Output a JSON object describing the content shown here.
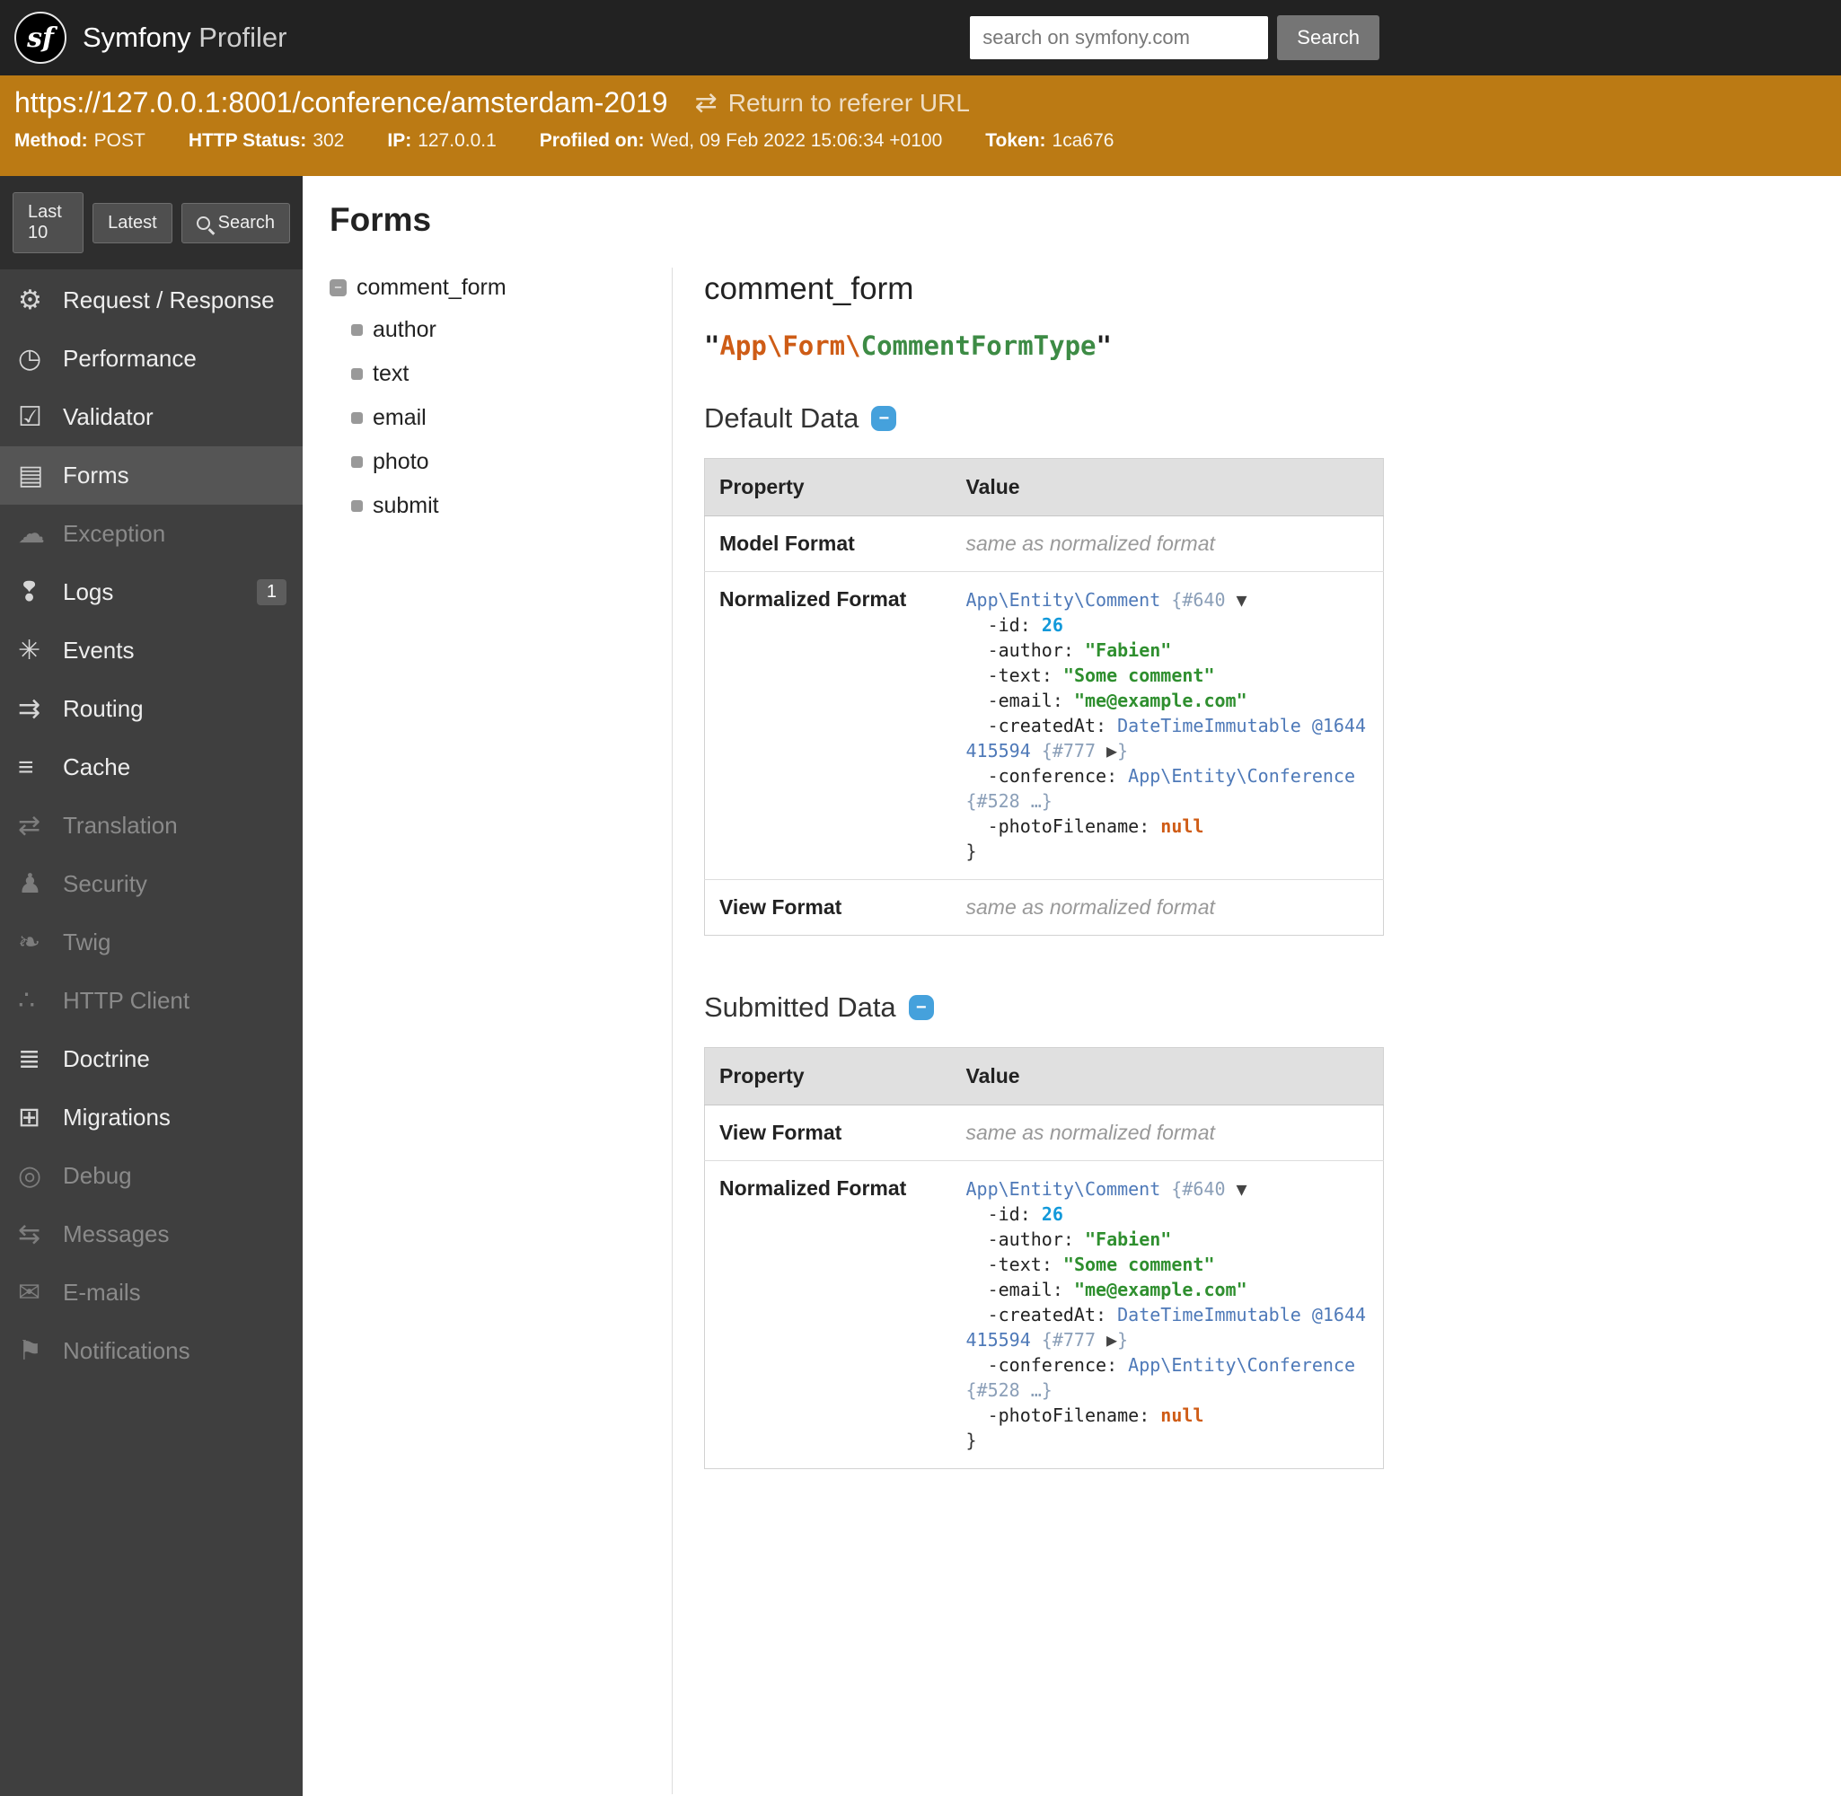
{
  "header": {
    "logo": "sf",
    "title_main": "Symfony",
    "title_sub": "Profiler",
    "search_placeholder": "search on symfony.com",
    "search_button": "Search"
  },
  "status_bar": {
    "url": "https://127.0.0.1:8001/conference/amsterdam-2019",
    "referer_link": "Return to referer URL",
    "meta": [
      {
        "label": "Method:",
        "value": "POST"
      },
      {
        "label": "HTTP Status:",
        "value": "302"
      },
      {
        "label": "IP:",
        "value": "127.0.0.1"
      },
      {
        "label": "Profiled on:",
        "value": "Wed, 09 Feb 2022 15:06:34 +0100"
      },
      {
        "label": "Token:",
        "value": "1ca676"
      }
    ]
  },
  "icon_glyphs": {
    "gears-icon": "⚙",
    "stopwatch-icon": "◷",
    "check-square-icon": "☑",
    "clipboard-icon": "▤",
    "ghost-icon": "☁",
    "logs-icon": "❢",
    "events-icon": "✳",
    "routing-icon": "⇉",
    "cache-icon": "≡",
    "translation-icon": "⇄",
    "security-icon": "♟",
    "twig-icon": "❧",
    "http-client-icon": "∴",
    "doctrine-icon": "≣",
    "migrations-icon": "⊞",
    "debug-icon": "◎",
    "messages-icon": "⇆",
    "emails-icon": "✉",
    "notifications-icon": "⚑"
  },
  "sidebar": {
    "buttons": [
      "Last 10",
      "Latest",
      "Search"
    ],
    "items": [
      {
        "label": "Request / Response",
        "icon": "gears-icon",
        "state": "enabled"
      },
      {
        "label": "Performance",
        "icon": "stopwatch-icon",
        "state": "enabled"
      },
      {
        "label": "Validator",
        "icon": "check-square-icon",
        "state": "enabled"
      },
      {
        "label": "Forms",
        "icon": "clipboard-icon",
        "state": "selected"
      },
      {
        "label": "Exception",
        "icon": "ghost-icon",
        "state": "disabled"
      },
      {
        "label": "Logs",
        "icon": "logs-icon",
        "state": "enabled",
        "badge": "1"
      },
      {
        "label": "Events",
        "icon": "events-icon",
        "state": "enabled"
      },
      {
        "label": "Routing",
        "icon": "routing-icon",
        "state": "enabled"
      },
      {
        "label": "Cache",
        "icon": "cache-icon",
        "state": "enabled"
      },
      {
        "label": "Translation",
        "icon": "translation-icon",
        "state": "disabled"
      },
      {
        "label": "Security",
        "icon": "security-icon",
        "state": "disabled"
      },
      {
        "label": "Twig",
        "icon": "twig-icon",
        "state": "disabled"
      },
      {
        "label": "HTTP Client",
        "icon": "http-client-icon",
        "state": "disabled"
      },
      {
        "label": "Doctrine",
        "icon": "doctrine-icon",
        "state": "enabled"
      },
      {
        "label": "Migrations",
        "icon": "migrations-icon",
        "state": "enabled"
      },
      {
        "label": "Debug",
        "icon": "debug-icon",
        "state": "disabled"
      },
      {
        "label": "Messages",
        "icon": "messages-icon",
        "state": "disabled"
      },
      {
        "label": "E-mails",
        "icon": "emails-icon",
        "state": "disabled"
      },
      {
        "label": "Notifications",
        "icon": "notifications-icon",
        "state": "disabled"
      }
    ]
  },
  "main": {
    "page_title": "Forms",
    "tree": {
      "root": "comment_form",
      "children": [
        "author",
        "text",
        "email",
        "photo",
        "submit"
      ]
    },
    "detail": {
      "title": "comment_form",
      "type_tokens": [
        {
          "t": "\"",
          "c": "q"
        },
        {
          "t": "App\\Form\\",
          "c": "ns"
        },
        {
          "t": "CommentFormType",
          "c": "cls"
        },
        {
          "t": "\"",
          "c": "q"
        }
      ],
      "sections": [
        {
          "heading": "Default Data",
          "columns": [
            "Property",
            "Value"
          ],
          "rows": [
            {
              "property": "Model Format",
              "type": "plain",
              "value": "same as normalized format"
            },
            {
              "property": "Normalized Format",
              "type": "dump",
              "dump": "comment_dump"
            },
            {
              "property": "View Format",
              "type": "plain",
              "value": "same as normalized format"
            }
          ]
        },
        {
          "heading": "Submitted Data",
          "columns": [
            "Property",
            "Value"
          ],
          "rows": [
            {
              "property": "View Format",
              "type": "plain",
              "value": "same as normalized format"
            },
            {
              "property": "Normalized Format",
              "type": "dump",
              "dump": "comment_dump"
            }
          ]
        }
      ],
      "dumps": {
        "comment_dump": [
          [
            {
              "t": "App\\Entity\\Comment",
              "c": "cls"
            },
            {
              "t": " ",
              "c": "p"
            },
            {
              "t": "{#640 ",
              "c": "note"
            },
            {
              "t": "▼",
              "c": "tog"
            }
          ],
          [
            {
              "t": "  -",
              "c": "p"
            },
            {
              "t": "id",
              "c": "key"
            },
            {
              "t": ": ",
              "c": "p"
            },
            {
              "t": "26",
              "c": "num"
            }
          ],
          [
            {
              "t": "  -",
              "c": "p"
            },
            {
              "t": "author",
              "c": "key"
            },
            {
              "t": ": ",
              "c": "p"
            },
            {
              "t": "\"Fabien\"",
              "c": "str"
            }
          ],
          [
            {
              "t": "  -",
              "c": "p"
            },
            {
              "t": "text",
              "c": "key"
            },
            {
              "t": ": ",
              "c": "p"
            },
            {
              "t": "\"Some comment\"",
              "c": "str"
            }
          ],
          [
            {
              "t": "  -",
              "c": "p"
            },
            {
              "t": "email",
              "c": "key"
            },
            {
              "t": ": ",
              "c": "p"
            },
            {
              "t": "\"me@example.com\"",
              "c": "str"
            }
          ],
          [
            {
              "t": "  -",
              "c": "p"
            },
            {
              "t": "createdAt",
              "c": "key"
            },
            {
              "t": ": ",
              "c": "p"
            },
            {
              "t": "DateTimeImmutable @1644415594",
              "c": "cls"
            },
            {
              "t": " ",
              "c": "p"
            },
            {
              "t": "{#777 ",
              "c": "note"
            },
            {
              "t": "▶",
              "c": "tog"
            },
            {
              "t": "}",
              "c": "note"
            }
          ],
          [
            {
              "t": "  -",
              "c": "p"
            },
            {
              "t": "conference",
              "c": "key"
            },
            {
              "t": ": ",
              "c": "p"
            },
            {
              "t": "App\\Entity\\Conference",
              "c": "cls"
            },
            {
              "t": " ",
              "c": "p"
            },
            {
              "t": "{#528 …}",
              "c": "note"
            }
          ],
          [
            {
              "t": "  -",
              "c": "p"
            },
            {
              "t": "photoFilename",
              "c": "key"
            },
            {
              "t": ": ",
              "c": "p"
            },
            {
              "t": "null",
              "c": "cst"
            }
          ],
          [
            {
              "t": "}",
              "c": "p"
            }
          ]
        ]
      }
    }
  }
}
